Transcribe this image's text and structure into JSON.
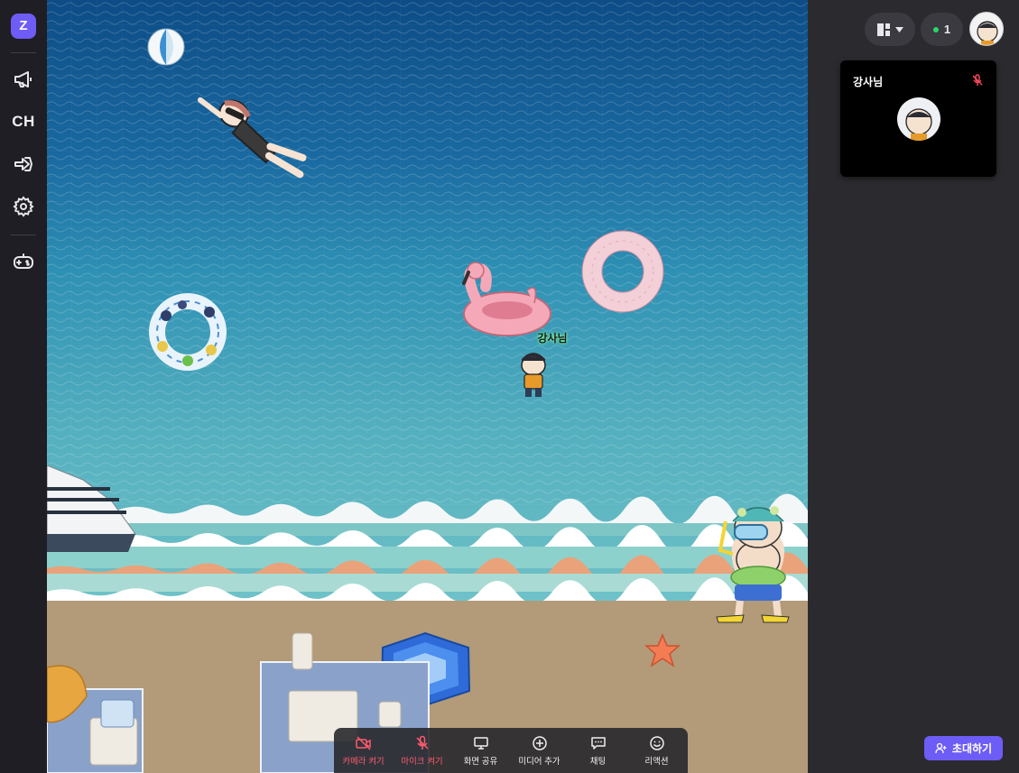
{
  "nav": {
    "logo_letter": "Z",
    "channel_label": "CH"
  },
  "map": {
    "player_name": "강사님"
  },
  "topbar": {
    "online_count": "1",
    "online_dot_color": "#2bd46a"
  },
  "video_card": {
    "name": "강사님",
    "mic_state": "muted",
    "mic_icon_color": "#ff4a5e"
  },
  "toolbar": {
    "items": [
      {
        "label": "카메라 켜기",
        "icon": "camera-off-icon",
        "state": "off"
      },
      {
        "label": "마이크 켜기",
        "icon": "mic-off-icon",
        "state": "off"
      },
      {
        "label": "화면 공유",
        "icon": "monitor-icon",
        "state": "normal"
      },
      {
        "label": "미디어 추가",
        "icon": "plus-circle-icon",
        "state": "normal"
      },
      {
        "label": "채팅",
        "icon": "chat-icon",
        "state": "normal"
      },
      {
        "label": "리액션",
        "icon": "smile-icon",
        "state": "normal"
      }
    ]
  },
  "invite": {
    "label": "초대하기",
    "color": "#6e5cf6"
  }
}
